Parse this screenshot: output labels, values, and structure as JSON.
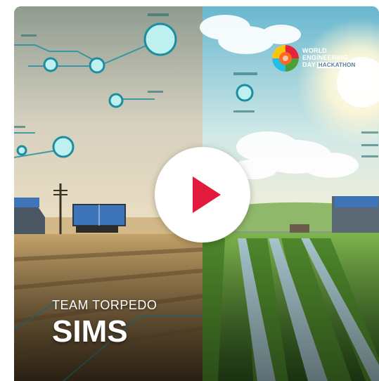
{
  "card": {
    "team_label": "TEAM TORPEDO",
    "title": "SIMS"
  },
  "logo": {
    "line1": "WORLD",
    "line2": "ENGINEERING",
    "line3": "DAY",
    "badge": "HACKATHON"
  },
  "play": {
    "icon": "play-icon"
  },
  "colors": {
    "play_accent": "#e21b3c",
    "play_background": "#ffffff",
    "text": "#ffffff"
  }
}
